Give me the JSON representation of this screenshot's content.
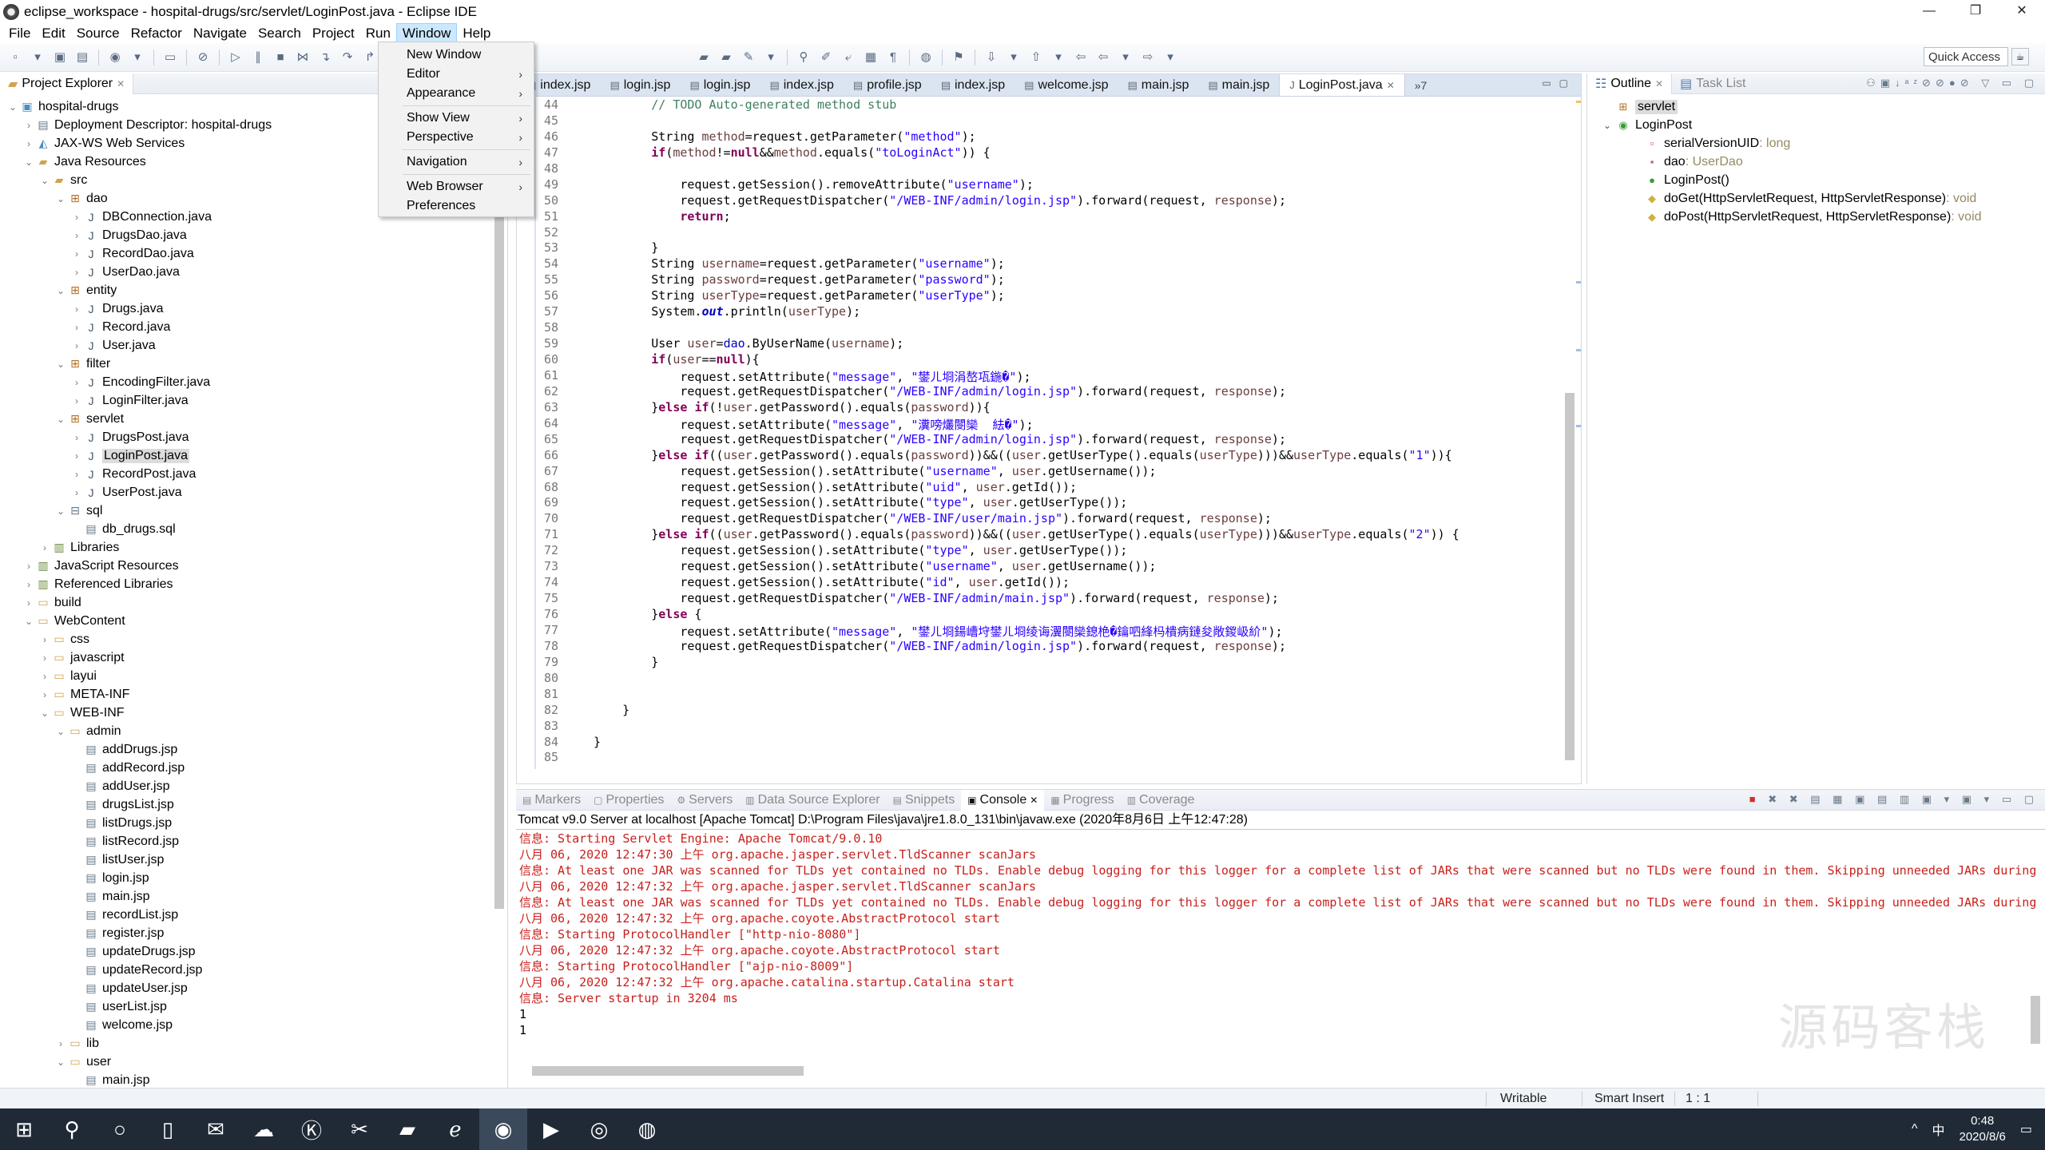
{
  "window": {
    "title": "eclipse_workspace - hospital-drugs/src/servlet/LoginPost.java - Eclipse IDE",
    "controls": {
      "minimize": "—",
      "restore": "❐",
      "close": "✕"
    }
  },
  "menubar": [
    "File",
    "Edit",
    "Source",
    "Refactor",
    "Navigate",
    "Search",
    "Project",
    "Run",
    "Window",
    "Help"
  ],
  "window_menu": {
    "items": [
      {
        "label": "New Window",
        "submenu": false
      },
      {
        "label": "Editor",
        "submenu": true
      },
      {
        "label": "Appearance",
        "submenu": true
      },
      {
        "sep": true
      },
      {
        "label": "Show View",
        "submenu": true
      },
      {
        "label": "Perspective",
        "submenu": true
      },
      {
        "sep": true
      },
      {
        "label": "Navigation",
        "submenu": true
      },
      {
        "sep": true
      },
      {
        "label": "Web Browser",
        "submenu": true
      },
      {
        "label": "Preferences",
        "submenu": false
      }
    ],
    "arrow": "›"
  },
  "toolbar": {
    "quick_access": "Quick Access"
  },
  "explorer": {
    "tab_label": "Project Explorer",
    "close": "✕",
    "tree": [
      {
        "level": 0,
        "expanded": true,
        "icon": "project",
        "label": "hospital-drugs"
      },
      {
        "level": 1,
        "expanded": false,
        "icon": "deploy",
        "label": "Deployment Descriptor: hospital-drugs"
      },
      {
        "level": 1,
        "expanded": false,
        "icon": "webservice",
        "label": "JAX-WS Web Services"
      },
      {
        "level": 1,
        "expanded": true,
        "icon": "javares",
        "label": "Java Resources"
      },
      {
        "level": 2,
        "expanded": true,
        "icon": "srcfolder",
        "label": "src"
      },
      {
        "level": 3,
        "expanded": true,
        "icon": "package",
        "label": "dao"
      },
      {
        "level": 4,
        "expanded": false,
        "icon": "java",
        "label": "DBConnection.java"
      },
      {
        "level": 4,
        "expanded": false,
        "icon": "java",
        "label": "DrugsDao.java"
      },
      {
        "level": 4,
        "expanded": false,
        "icon": "java",
        "label": "RecordDao.java"
      },
      {
        "level": 4,
        "expanded": false,
        "icon": "java",
        "label": "UserDao.java"
      },
      {
        "level": 3,
        "expanded": true,
        "icon": "package",
        "label": "entity"
      },
      {
        "level": 4,
        "expanded": false,
        "icon": "java",
        "label": "Drugs.java"
      },
      {
        "level": 4,
        "expanded": false,
        "icon": "java",
        "label": "Record.java"
      },
      {
        "level": 4,
        "expanded": false,
        "icon": "java",
        "label": "User.java"
      },
      {
        "level": 3,
        "expanded": true,
        "icon": "package",
        "label": "filter"
      },
      {
        "level": 4,
        "expanded": false,
        "icon": "java",
        "label": "EncodingFilter.java"
      },
      {
        "level": 4,
        "expanded": false,
        "icon": "java",
        "label": "LoginFilter.java"
      },
      {
        "level": 3,
        "expanded": true,
        "icon": "package",
        "label": "servlet"
      },
      {
        "level": 4,
        "expanded": false,
        "icon": "java",
        "label": "DrugsPost.java"
      },
      {
        "level": 4,
        "expanded": false,
        "icon": "java",
        "label": "LoginPost.java",
        "selected": true
      },
      {
        "level": 4,
        "expanded": false,
        "icon": "java",
        "label": "RecordPost.java"
      },
      {
        "level": 4,
        "expanded": false,
        "icon": "java",
        "label": "UserPost.java"
      },
      {
        "level": 3,
        "expanded": true,
        "icon": "emptypackage",
        "label": "sql"
      },
      {
        "level": 4,
        "leaf": true,
        "icon": "file",
        "label": "db_drugs.sql"
      },
      {
        "level": 2,
        "expanded": false,
        "icon": "library",
        "label": "Libraries"
      },
      {
        "level": 1,
        "expanded": false,
        "icon": "library",
        "label": "JavaScript Resources"
      },
      {
        "level": 1,
        "expanded": false,
        "icon": "library",
        "label": "Referenced Libraries"
      },
      {
        "level": 1,
        "expanded": false,
        "icon": "folder",
        "label": "build"
      },
      {
        "level": 1,
        "expanded": true,
        "icon": "folder",
        "label": "WebContent"
      },
      {
        "level": 2,
        "expanded": false,
        "icon": "folder",
        "label": "css"
      },
      {
        "level": 2,
        "expanded": false,
        "icon": "folder",
        "label": "javascript"
      },
      {
        "level": 2,
        "expanded": false,
        "icon": "folder",
        "label": "layui"
      },
      {
        "level": 2,
        "expanded": false,
        "icon": "folder",
        "label": "META-INF"
      },
      {
        "level": 2,
        "expanded": true,
        "icon": "folder",
        "label": "WEB-INF"
      },
      {
        "level": 3,
        "expanded": true,
        "icon": "folder",
        "label": "admin"
      },
      {
        "level": 4,
        "leaf": true,
        "icon": "file",
        "label": "addDrugs.jsp"
      },
      {
        "level": 4,
        "leaf": true,
        "icon": "file",
        "label": "addRecord.jsp"
      },
      {
        "level": 4,
        "leaf": true,
        "icon": "file",
        "label": "addUser.jsp"
      },
      {
        "level": 4,
        "leaf": true,
        "icon": "file",
        "label": "drugsList.jsp"
      },
      {
        "level": 4,
        "leaf": true,
        "icon": "file",
        "label": "listDrugs.jsp"
      },
      {
        "level": 4,
        "leaf": true,
        "icon": "file",
        "label": "listRecord.jsp"
      },
      {
        "level": 4,
        "leaf": true,
        "icon": "file",
        "label": "listUser.jsp"
      },
      {
        "level": 4,
        "leaf": true,
        "icon": "file",
        "label": "login.jsp"
      },
      {
        "level": 4,
        "leaf": true,
        "icon": "file",
        "label": "main.jsp"
      },
      {
        "level": 4,
        "leaf": true,
        "icon": "file",
        "label": "recordList.jsp"
      },
      {
        "level": 4,
        "leaf": true,
        "icon": "file",
        "label": "register.jsp"
      },
      {
        "level": 4,
        "leaf": true,
        "icon": "file",
        "label": "updateDrugs.jsp"
      },
      {
        "level": 4,
        "leaf": true,
        "icon": "file",
        "label": "updateRecord.jsp"
      },
      {
        "level": 4,
        "leaf": true,
        "icon": "file",
        "label": "updateUser.jsp"
      },
      {
        "level": 4,
        "leaf": true,
        "icon": "file",
        "label": "userList.jsp"
      },
      {
        "level": 4,
        "leaf": true,
        "icon": "file",
        "label": "welcome.jsp"
      },
      {
        "level": 3,
        "expanded": false,
        "icon": "folder",
        "label": "lib"
      },
      {
        "level": 3,
        "expanded": true,
        "icon": "folder",
        "label": "user"
      },
      {
        "level": 4,
        "leaf": true,
        "icon": "file",
        "label": "main.jsp"
      }
    ]
  },
  "editor": {
    "tabs": [
      {
        "label": "index.jsp"
      },
      {
        "label": "login.jsp"
      },
      {
        "label": "login.jsp"
      },
      {
        "label": "index.jsp"
      },
      {
        "label": "profile.jsp"
      },
      {
        "label": "index.jsp"
      },
      {
        "label": "welcome.jsp"
      },
      {
        "label": "main.jsp"
      },
      {
        "label": "main.jsp"
      },
      {
        "label": "LoginPost.java",
        "active": true
      }
    ],
    "overflow_label": "»7",
    "lines": [
      {
        "n": "44",
        "code": "        // TODO Auto-generated method stub"
      },
      {
        "n": "45",
        "code": ""
      },
      {
        "n": "46",
        "code": "        String method=request.getParameter(\"method\");"
      },
      {
        "n": "47",
        "code": "        if(method!=null&&method.equals(\"toLoginAct\")) {"
      },
      {
        "n": "48",
        "code": ""
      },
      {
        "n": "49",
        "code": "            request.getSession().removeAttribute(\"username\");"
      },
      {
        "n": "50",
        "code": "            request.getRequestDispatcher(\"/WEB-INF/admin/login.jsp\").forward(request, response);"
      },
      {
        "n": "51",
        "code": "            return;"
      },
      {
        "n": "52",
        "code": ""
      },
      {
        "n": "53",
        "code": "        }"
      },
      {
        "n": "54",
        "code": "        String username=request.getParameter(\"username\");"
      },
      {
        "n": "55",
        "code": "        String password=request.getParameter(\"password\");"
      },
      {
        "n": "56",
        "code": "        String userType=request.getParameter(\"userType\");"
      },
      {
        "n": "57",
        "code": "        System.out.println(userType);"
      },
      {
        "n": "58",
        "code": ""
      },
      {
        "n": "59",
        "code": "        User user=dao.ByUserName(username);"
      },
      {
        "n": "60",
        "code": "        if(user==null){"
      },
      {
        "n": "61",
        "code": "            request.setAttribute(\"message\", \"鐢ㄦ埛涓嶅瓨鍦�\");"
      },
      {
        "n": "62",
        "code": "            request.getRequestDispatcher(\"/WEB-INF/admin/login.jsp\").forward(request, response);"
      },
      {
        "n": "63",
        "code": "        }else if(!user.getPassword().equals(password)){"
      },
      {
        "n": "64",
        "code": "            request.setAttribute(\"message\", \"瀵嗙爜閿欒  紶�\");"
      },
      {
        "n": "65",
        "code": "            request.getRequestDispatcher(\"/WEB-INF/admin/login.jsp\").forward(request, response);"
      },
      {
        "n": "66",
        "code": "        }else if((user.getPassword().equals(password))&&((user.getUserType().equals(userType)))&&userType.equals(\"1\")){"
      },
      {
        "n": "67",
        "code": "            request.getSession().setAttribute(\"username\", user.getUsername());"
      },
      {
        "n": "68",
        "code": "            request.getSession().setAttribute(\"uid\", user.getId());"
      },
      {
        "n": "69",
        "code": "            request.getSession().setAttribute(\"type\", user.getUserType());"
      },
      {
        "n": "70",
        "code": "            request.getRequestDispatcher(\"/WEB-INF/user/main.jsp\").forward(request, response);"
      },
      {
        "n": "71",
        "code": "        }else if((user.getPassword().equals(password))&&((user.getUserType().equals(userType)))&&userType.equals(\"2\")) {"
      },
      {
        "n": "72",
        "code": "            request.getSession().setAttribute(\"type\", user.getUserType());"
      },
      {
        "n": "73",
        "code": "            request.getSession().setAttribute(\"username\", user.getUsername());"
      },
      {
        "n": "74",
        "code": "            request.getSession().setAttribute(\"id\", user.getId());"
      },
      {
        "n": "75",
        "code": "            request.getRequestDispatcher(\"/WEB-INF/admin/main.jsp\").forward(request, response);"
      },
      {
        "n": "76",
        "code": "        }else {"
      },
      {
        "n": "77",
        "code": "            request.setAttribute(\"message\", \"鐢ㄦ埛鍚嶆垨鐢ㄦ埛绫诲瀷閿欒鎴栬�鑰呬綘杩樻病鏈夋敞鍐岋紒\");"
      },
      {
        "n": "78",
        "code": "            request.getRequestDispatcher(\"/WEB-INF/admin/login.jsp\").forward(request, response);"
      },
      {
        "n": "79",
        "code": "        }"
      },
      {
        "n": "80",
        "code": ""
      },
      {
        "n": "81",
        "code": ""
      },
      {
        "n": "82",
        "code": "    }"
      },
      {
        "n": "83",
        "code": ""
      },
      {
        "n": "84",
        "code": "}"
      },
      {
        "n": "85",
        "code": ""
      }
    ]
  },
  "outline": {
    "tabs": [
      {
        "label": "Outline",
        "active": true
      },
      {
        "label": "Task List",
        "active": false
      }
    ],
    "items": [
      {
        "indent": 0,
        "icon": "package",
        "label": "servlet",
        "type": "",
        "selected": true
      },
      {
        "indent": 0,
        "chev": true,
        "icon": "class",
        "label": "LoginPost",
        "type": ""
      },
      {
        "indent": 1,
        "icon": "static-final-field",
        "label": "serialVersionUID",
        "type": " : long"
      },
      {
        "indent": 1,
        "icon": "private-field",
        "label": "dao",
        "type": " : UserDao"
      },
      {
        "indent": 1,
        "icon": "constructor",
        "label": "LoginPost()",
        "type": ""
      },
      {
        "indent": 1,
        "icon": "protected-method",
        "label": "doGet(HttpServletRequest, HttpServletResponse)",
        "type": " : void"
      },
      {
        "indent": 1,
        "icon": "protected-method",
        "label": "doPost(HttpServletRequest, HttpServletResponse)",
        "type": " : void"
      }
    ]
  },
  "bottom_panel": {
    "tabs": [
      {
        "label": "Markers",
        "icon": "▤"
      },
      {
        "label": "Properties",
        "icon": "▢"
      },
      {
        "label": "Servers",
        "icon": "⚙"
      },
      {
        "label": "Data Source Explorer",
        "icon": "▥"
      },
      {
        "label": "Snippets",
        "icon": "▤"
      },
      {
        "label": "Console",
        "icon": "▣",
        "active": true
      },
      {
        "label": "Progress",
        "icon": "▦"
      },
      {
        "label": "Coverage",
        "icon": "▥"
      }
    ],
    "console_header": "Tomcat v9.0 Server at localhost [Apache Tomcat] D:\\Program Files\\java\\jre1.8.0_131\\bin\\javaw.exe (2020年8月6日 上午12:47:28)",
    "console_lines": [
      {
        "text": "信息: Starting Servlet Engine: Apache Tomcat/9.0.10",
        "err": true
      },
      {
        "text": "八月 06, 2020 12:47:30 上午 org.apache.jasper.servlet.TldScanner scanJars",
        "err": true
      },
      {
        "text": "信息: At least one JAR was scanned for TLDs yet contained no TLDs. Enable debug logging for this logger for a complete list of JARs that were scanned but no TLDs were found in them. Skipping unneeded JARs during",
        "err": true
      },
      {
        "text": "八月 06, 2020 12:47:32 上午 org.apache.jasper.servlet.TldScanner scanJars",
        "err": true
      },
      {
        "text": "信息: At least one JAR was scanned for TLDs yet contained no TLDs. Enable debug logging for this logger for a complete list of JARs that were scanned but no TLDs were found in them. Skipping unneeded JARs during",
        "err": true
      },
      {
        "text": "八月 06, 2020 12:47:32 上午 org.apache.coyote.AbstractProtocol start",
        "err": true
      },
      {
        "text": "信息: Starting ProtocolHandler [\"http-nio-8080\"]",
        "err": true
      },
      {
        "text": "八月 06, 2020 12:47:32 上午 org.apache.coyote.AbstractProtocol start",
        "err": true
      },
      {
        "text": "信息: Starting ProtocolHandler [\"ajp-nio-8009\"]",
        "err": true
      },
      {
        "text": "八月 06, 2020 12:47:32 上午 org.apache.catalina.startup.Catalina start",
        "err": true
      },
      {
        "text": "信息: Server startup in 3204 ms",
        "err": true
      },
      {
        "text": "1",
        "err": false
      },
      {
        "text": "1",
        "err": false
      }
    ],
    "watermark": "源码客栈"
  },
  "statusbar": {
    "writable": "Writable",
    "insert_mode": "Smart Insert",
    "position": "1 : 1"
  },
  "taskbar": {
    "apps": [
      "start",
      "search",
      "cortana",
      "task-view",
      "mail",
      "baidu-netdisk",
      "kugou",
      "tools",
      "file-explorer",
      "edge",
      "eclipse",
      "video",
      "chrome",
      "browser-360"
    ],
    "tray": {
      "chevron": "^",
      "ime": "中",
      "time": "0:48",
      "date": "2020/8/6"
    }
  }
}
